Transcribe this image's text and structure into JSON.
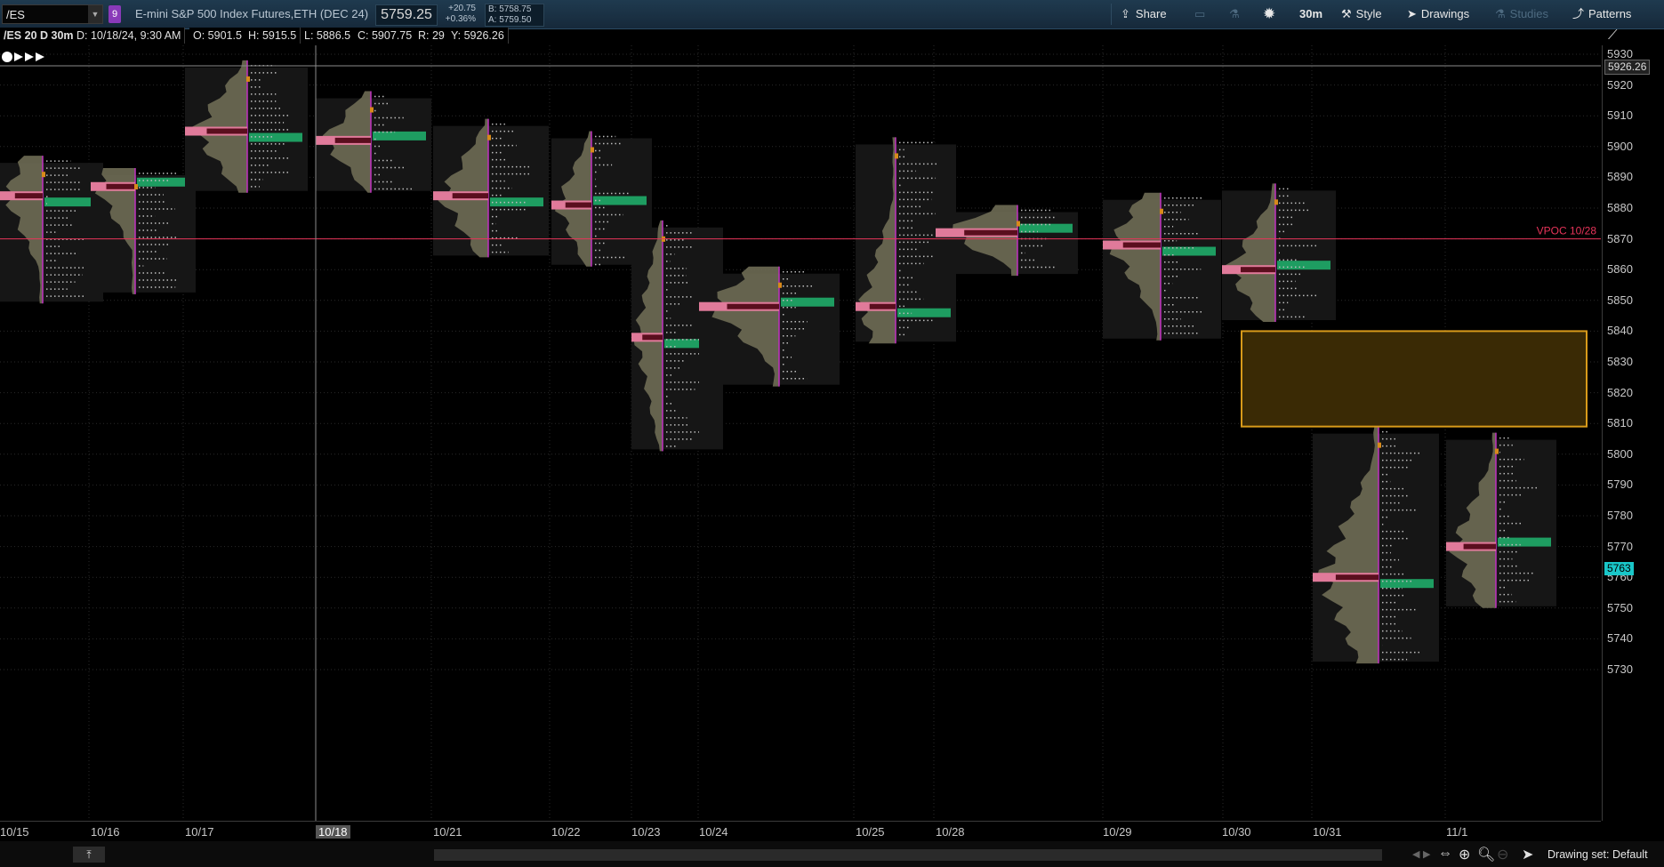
{
  "toolbar": {
    "symbol": "/ES",
    "link_badge": "9",
    "instrument": "E-mini S&P 500 Index Futures,ETH (DEC 24)",
    "last_price": "5759.25",
    "change": "+20.75",
    "change_pct": "+0.36%",
    "bid": "B: 5758.75",
    "ask": "A: 5759.50",
    "share": "Share",
    "timeframe": "30m",
    "style": "Style",
    "drawings": "Drawings",
    "studies": "Studies",
    "patterns": "Patterns"
  },
  "infobar": {
    "title": "/ES 20 D 30m",
    "date": "D: 10/18/24, 9:30 AM",
    "open": "O: 5901.5",
    "high": "H: 5915.5",
    "low": "L: 5886.5",
    "close": "C: 5907.75",
    "range": "R: 29",
    "y": "Y: 5926.26"
  },
  "price_axis": {
    "ticks": [
      "5930",
      "5920",
      "5910",
      "5900",
      "5890",
      "5880",
      "5870",
      "5860",
      "5850",
      "5840",
      "5830",
      "5820",
      "5810",
      "5800",
      "5790",
      "5780",
      "5770",
      "5760",
      "5750",
      "5740",
      "5730"
    ],
    "crosshair_label": "5926.26",
    "last_label": "5763",
    "last_color": "#19c6c8"
  },
  "time_axis": {
    "dates": [
      "10/15",
      "10/16",
      "10/17",
      "10/18",
      "10/21",
      "10/22",
      "10/23",
      "10/24",
      "10/25",
      "10/28",
      "10/29",
      "10/30",
      "10/31",
      "11/1"
    ],
    "selected": "10/18"
  },
  "annotations": {
    "vpoc_label": "VPOC 10/28",
    "vpoc_price": 5870,
    "zone": {
      "from": 5809,
      "to": 5840
    }
  },
  "bottom": {
    "drawing_set": "Drawing set: Default"
  },
  "colors": {
    "vpoc": "#e8345a",
    "profile": "#6e6b54",
    "poc": "#e07a9a",
    "value_area": "#1e9d61",
    "zone_border": "#d89a1a",
    "zone_fill": "#3a2a05"
  },
  "chart_data": {
    "type": "market-profile",
    "sessions": [
      {
        "date": "10/15",
        "poc": 5884,
        "high": 5897,
        "low": 5849
      },
      {
        "date": "10/16",
        "poc": 5887,
        "high": 5893,
        "low": 5852
      },
      {
        "date": "10/17",
        "poc": 5905,
        "high": 5928,
        "low": 5885
      },
      {
        "date": "10/18",
        "poc": 5902,
        "high": 5918,
        "low": 5885
      },
      {
        "date": "10/21",
        "poc": 5884,
        "high": 5909,
        "low": 5864
      },
      {
        "date": "10/22",
        "poc": 5881,
        "high": 5905,
        "low": 5861
      },
      {
        "date": "10/23",
        "poc": 5838,
        "high": 5876,
        "low": 5801
      },
      {
        "date": "10/24",
        "poc": 5848,
        "high": 5861,
        "low": 5822
      },
      {
        "date": "10/25",
        "poc": 5848,
        "high": 5903,
        "low": 5836
      },
      {
        "date": "10/28",
        "poc": 5872,
        "high": 5881,
        "low": 5858
      },
      {
        "date": "10/29",
        "poc": 5868,
        "high": 5885,
        "low": 5837
      },
      {
        "date": "10/30",
        "poc": 5860,
        "high": 5888,
        "low": 5843
      },
      {
        "date": "10/31",
        "poc": 5760,
        "high": 5809,
        "low": 5732
      },
      {
        "date": "11/1",
        "poc": 5770,
        "high": 5807,
        "low": 5750
      }
    ]
  }
}
